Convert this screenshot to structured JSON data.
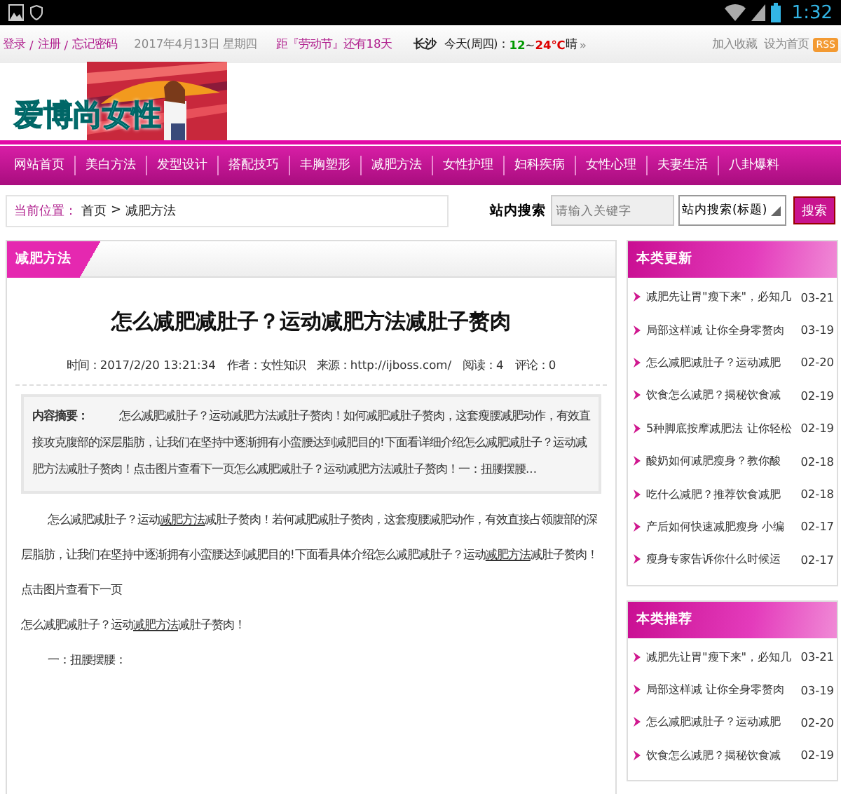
{
  "status_bar": {
    "time": "1:32"
  },
  "top_bar": {
    "account_links": [
      "登录",
      "注册",
      "忘记密码"
    ],
    "separator": "/",
    "date": "2017年4月13日 星期四",
    "countdown": "距『劳动节』还有18天",
    "weather": {
      "city": "长沙",
      "day": "今天(周四)：",
      "low": "12",
      "range_sep": "~",
      "high": "24℃",
      "condition": "晴",
      "more": "»"
    },
    "right_links": [
      "加入收藏",
      "设为首页"
    ],
    "rss": "RSS"
  },
  "header": {
    "logo_text": "爱博尚女性"
  },
  "nav": [
    "网站首页",
    "美白方法",
    "发型设计",
    "搭配技巧",
    "丰胸塑形",
    "减肥方法",
    "女性护理",
    "妇科疾病",
    "女性心理",
    "夫妻生活",
    "八卦爆料"
  ],
  "breadcrumb": {
    "label": "当前位置：",
    "items": [
      "首页",
      "减肥方法"
    ],
    "separator": ">"
  },
  "search": {
    "label": "站内搜索",
    "placeholder": "请输入关键字",
    "scope": "站内搜索(标题)",
    "button": "搜索"
  },
  "article": {
    "section": "减肥方法",
    "title": "怎么减肥减肚子？运动减肥方法减肚子赘肉",
    "meta": [
      "时间：2017/2/20 13:21:34",
      "作者：女性知识",
      "来源：http://ijboss.com/",
      "阅读：4",
      "评论：0"
    ],
    "summary": {
      "label": "内容摘要：",
      "text": "怎么减肥减肚子？运动减肥方法减肚子赘肉！如何减肥减肚子赘肉，这套瘦腰减肥动作，有效直接攻克腹部的深层脂肪，让我们在坚持中逐渐拥有小蛮腰达到减肥目的!下面看详细介绍怎么减肥减肚子？运动减肥方法减肚子赘肉！点击图片查看下一页怎么减肥减肚子？运动减肥方法减肚子赘肉！一：扭腰摆腰..."
    },
    "paragraphs": [
      {
        "indent": true,
        "runs": [
          {
            "text": "怎么减肥减肚子？运动",
            "link": false
          },
          {
            "text": "减肥方法",
            "link": true
          },
          {
            "text": "减肚子赘肉！若何减肥减肚子赘肉，这套瘦腰减肥动作，有效直接占领腹部的深层脂肪，让我们在坚持中逐渐拥有小蛮腰达到减肥目的!下面看具体介绍怎么减肥减肚子？运动",
            "link": false
          },
          {
            "text": "减肥方法",
            "link": true
          },
          {
            "text": "减肚子赘肉！",
            "link": false
          }
        ]
      },
      {
        "indent": false,
        "runs": [
          {
            "text": "点击图片查看下一页",
            "link": false
          }
        ]
      },
      {
        "indent": false,
        "runs": [
          {
            "text": "怎么减肥减肚子？运动",
            "link": false
          },
          {
            "text": "减肥方法",
            "link": true
          },
          {
            "text": "减肚子赘肉！",
            "link": false
          }
        ]
      },
      {
        "indent": true,
        "runs": [
          {
            "text": "一：扭腰摆腰：",
            "link": false
          }
        ]
      }
    ]
  },
  "sidebar": [
    {
      "title": "本类更新",
      "items": [
        {
          "title": "减肥先让胃\"瘦下来\"，必知几",
          "date": "03-21"
        },
        {
          "title": "局部这样减 让你全身零赘肉",
          "date": "03-19"
        },
        {
          "title": "怎么减肥减肚子？运动减肥",
          "date": "02-20"
        },
        {
          "title": "饮食怎么减肥？揭秘饮食减",
          "date": "02-19"
        },
        {
          "title": "5种脚底按摩减肥法 让你轻松",
          "date": "02-19"
        },
        {
          "title": "酸奶如何减肥瘦身？教你酸",
          "date": "02-18"
        },
        {
          "title": "吃什么减肥？推荐饮食减肥",
          "date": "02-18"
        },
        {
          "title": "产后如何快速减肥瘦身 小编",
          "date": "02-17"
        },
        {
          "title": "瘦身专家告诉你什么时候运",
          "date": "02-17"
        }
      ]
    },
    {
      "title": "本类推荐",
      "items": [
        {
          "title": "减肥先让胃\"瘦下来\"，必知几",
          "date": "03-21"
        },
        {
          "title": "局部这样减 让你全身零赘肉",
          "date": "03-19"
        },
        {
          "title": "怎么减肥减肚子？运动减肥",
          "date": "02-20"
        },
        {
          "title": "饮食怎么减肥？揭秘饮食减",
          "date": "02-19"
        }
      ]
    }
  ]
}
